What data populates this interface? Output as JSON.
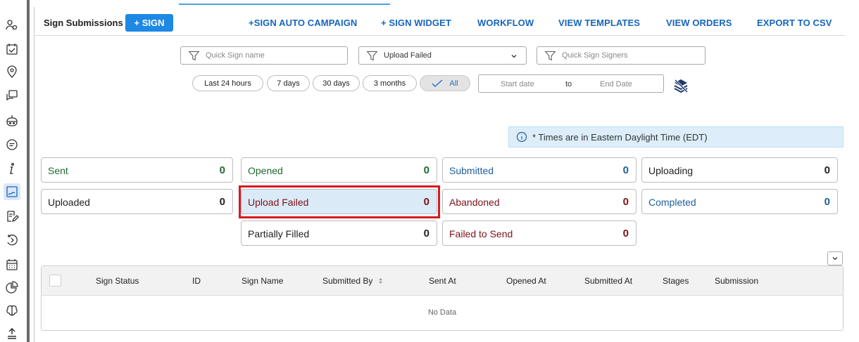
{
  "header": {
    "title": "Sign Submissions",
    "sign_button": "+ SIGN",
    "links": [
      "+SIGN AUTO CAMPAIGN",
      "+ SIGN WIDGET",
      "WORKFLOW",
      "VIEW TEMPLATES",
      "VIEW ORDERS",
      "EXPORT TO CSV"
    ]
  },
  "filters": {
    "name_placeholder": "Quick Sign name",
    "status_selected": "Upload Failed",
    "signers_placeholder": "Quick Sign Signers"
  },
  "time_ranges": [
    "Last 24 hours",
    "7 days",
    "30 days",
    "3 months",
    "All"
  ],
  "time_range_selected": "All",
  "date_range": {
    "start_placeholder": "Start date",
    "separator": "to",
    "end_placeholder": "End Date"
  },
  "info_banner": "* Times are in Eastern Daylight Time (EDT)",
  "status_cards": [
    {
      "label": "Sent",
      "count": "0"
    },
    {
      "label": "Opened",
      "count": "0"
    },
    {
      "label": "Submitted",
      "count": "0"
    },
    {
      "label": "Uploading",
      "count": "0"
    },
    {
      "label": "Uploaded",
      "count": "0"
    },
    {
      "label": "Upload Failed",
      "count": "0"
    },
    {
      "label": "Abandoned",
      "count": "0"
    },
    {
      "label": "Completed",
      "count": "0"
    },
    {
      "label": "Partially Filled",
      "count": "0"
    },
    {
      "label": "Failed to Send",
      "count": "0"
    }
  ],
  "selected_status": "Upload Failed",
  "table": {
    "columns": [
      "Sign Status",
      "ID",
      "Sign Name",
      "Submitted By",
      "Sent At",
      "Opened At",
      "Submitted At",
      "Stages",
      "Submission"
    ],
    "empty_text": "No Data"
  },
  "colors": {
    "accent": "#1e88e5",
    "green": "#1f6b33",
    "red": "#7a1318",
    "blue": "#1d5f9a",
    "highlight": "#d71920"
  },
  "rail_icons": [
    "users-icon",
    "tasks-icon",
    "location-icon",
    "chat-icon",
    "bot-icon",
    "message-icon",
    "info-icon",
    "sign-document-icon",
    "edit-icon",
    "history-icon",
    "calendar-icon",
    "pie-chart-icon",
    "brain-icon",
    "upload-icon"
  ]
}
